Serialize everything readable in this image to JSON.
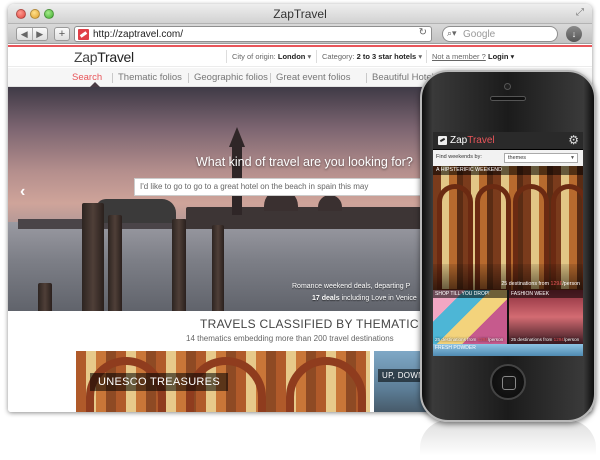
{
  "window": {
    "title": "ZapTravel",
    "url": "http://zaptravel.com/",
    "search_placeholder": "Google"
  },
  "header": {
    "logo_a": "Zap",
    "logo_b": "Travel",
    "origin_label": "City of origin:",
    "origin_value": "London",
    "category_label": "Category:",
    "category_value": "2 to 3 star hotels",
    "member_link": "Not a member ?",
    "login": "Login"
  },
  "nav": {
    "items": [
      "Search",
      "Thematic folios",
      "Geographic folios",
      "Great event folios",
      "Beautiful Hotels"
    ]
  },
  "hero": {
    "question": "What kind of travel are you looking for?",
    "search_value": "I'd like to go to go to a great hotel on the beach in spain this may",
    "promo": "Romance weekend deals, departing P",
    "deals_count": "17 deals",
    "deals_text": "including",
    "deals_place": "Love in Venice"
  },
  "thematic": {
    "title": "TRAVELS CLASSIFIED BY THEMATIC",
    "subtitle": "14 thematics embedding more than 200 travel destinations",
    "tiles": [
      "UNESCO TREASURES",
      "UP, DOWN"
    ]
  },
  "phone_app": {
    "logo_a": "Zap",
    "logo_b": "Travel",
    "filter_label": "Find weekends by:",
    "filter_value": "themes",
    "feature_title": "A HIPSTERIFIC WEEKEND",
    "feature_count": "25 destinations from",
    "feature_price": "129£",
    "feature_unit": "/person",
    "tile1_title": "SHOP TILL YOU DROP!",
    "tile1_count": "25 destinations from",
    "tile1_price": "129£",
    "tile1_unit": "/person",
    "tile2_title": "FASHION WEEK",
    "tile2_count": "25 destinations from",
    "tile2_price": "129£",
    "tile2_unit": "/person",
    "tile3_title": "FRESH POWDER"
  },
  "colors": {
    "accent": "#e8555a",
    "phone_bar": "#2a2a2a"
  },
  "icons": [
    "back-arrow-icon",
    "forward-arrow-icon",
    "plus-icon",
    "reload-icon",
    "search-icon",
    "download-icon",
    "gear-icon",
    "chevron-left-icon"
  ]
}
